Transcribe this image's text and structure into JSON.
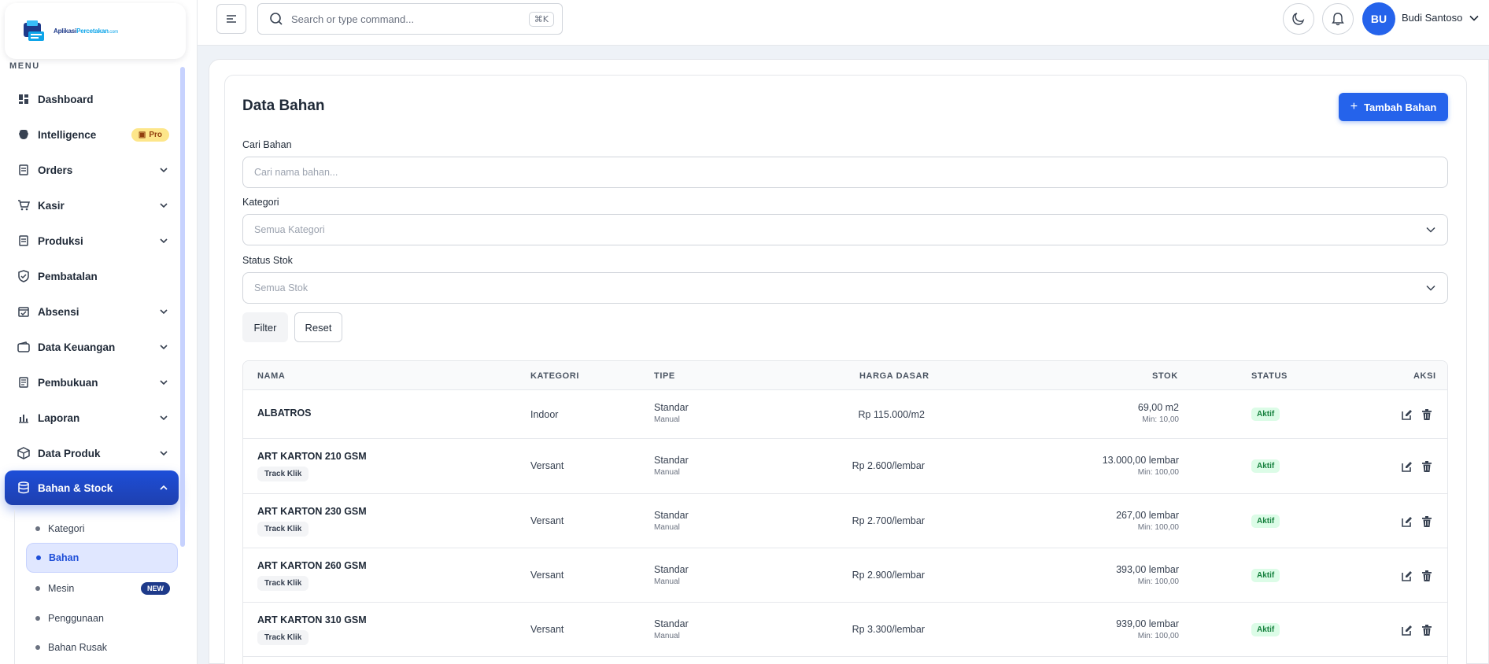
{
  "brand": {
    "name_prefix": "Aplikasi",
    "name_highlight": "Percetakan",
    "name_suffix": ".com"
  },
  "sidebar": {
    "menu_title": "MENU",
    "items": [
      {
        "label": "Dashboard",
        "icon": "dashboard-icon"
      },
      {
        "label": "Intelligence",
        "icon": "brain-icon",
        "badge": "Pro"
      },
      {
        "label": "Orders",
        "icon": "orders-icon"
      },
      {
        "label": "Kasir",
        "icon": "cart-icon"
      },
      {
        "label": "Produksi",
        "icon": "production-icon"
      },
      {
        "label": "Pembatalan",
        "icon": "shield-icon"
      },
      {
        "label": "Absensi",
        "icon": "calendar-check-icon"
      },
      {
        "label": "Data Keuangan",
        "icon": "wallet-icon"
      },
      {
        "label": "Pembukuan",
        "icon": "ledger-icon"
      },
      {
        "label": "Laporan",
        "icon": "bar-chart-icon"
      },
      {
        "label": "Data Produk",
        "icon": "box-icon"
      },
      {
        "label": "Bahan & Stock",
        "icon": "database-icon"
      }
    ],
    "sub_items": [
      {
        "label": "Kategori"
      },
      {
        "label": "Bahan"
      },
      {
        "label": "Mesin",
        "badge": "NEW"
      },
      {
        "label": "Penggunaan"
      },
      {
        "label": "Bahan Rusak"
      }
    ]
  },
  "topbar": {
    "search_placeholder": "Search or type command...",
    "shortcut": "⌘K",
    "avatar_initials": "BU",
    "user_name": "Budi Santoso"
  },
  "page": {
    "title": "Data Bahan",
    "add_button": "Tambah Bahan",
    "search_label": "Cari Bahan",
    "search_placeholder": "Cari nama bahan...",
    "category_label": "Kategori",
    "category_value": "Semua Kategori",
    "stock_label": "Status Stok",
    "stock_value": "Semua Stok",
    "filter_button": "Filter",
    "reset_button": "Reset"
  },
  "table": {
    "headers": {
      "nama": "NAMA",
      "kategori": "KATEGORI",
      "tipe": "TIPE",
      "harga": "HARGA DASAR",
      "stok": "STOK",
      "status": "STATUS",
      "aksi": "AKSI"
    },
    "rows": [
      {
        "nama": "ALBATROS",
        "tag": "",
        "kategori": "Indoor",
        "tipe": "Standar",
        "tipe_sub": "Manual",
        "harga": "Rp 115.000/m2",
        "stok": "69,00 m2",
        "min": "Min: 10,00",
        "status": "Aktif"
      },
      {
        "nama": "ART KARTON 210 GSM",
        "tag": "Track Klik",
        "kategori": "Versant",
        "tipe": "Standar",
        "tipe_sub": "Manual",
        "harga": "Rp 2.600/lembar",
        "stok": "13.000,00 lembar",
        "min": "Min: 100,00",
        "status": "Aktif"
      },
      {
        "nama": "ART KARTON 230 GSM",
        "tag": "Track Klik",
        "kategori": "Versant",
        "tipe": "Standar",
        "tipe_sub": "Manual",
        "harga": "Rp 2.700/lembar",
        "stok": "267,00 lembar",
        "min": "Min: 100,00",
        "status": "Aktif"
      },
      {
        "nama": "ART KARTON 260 GSM",
        "tag": "Track Klik",
        "kategori": "Versant",
        "tipe": "Standar",
        "tipe_sub": "Manual",
        "harga": "Rp 2.900/lembar",
        "stok": "393,00 lembar",
        "min": "Min: 100,00",
        "status": "Aktif"
      },
      {
        "nama": "ART KARTON 310 GSM",
        "tag": "Track Klik",
        "kategori": "Versant",
        "tipe": "Standar",
        "tipe_sub": "Manual",
        "harga": "Rp 3.300/lembar",
        "stok": "939,00 lembar",
        "min": "Min: 100,00",
        "status": "Aktif"
      }
    ]
  }
}
